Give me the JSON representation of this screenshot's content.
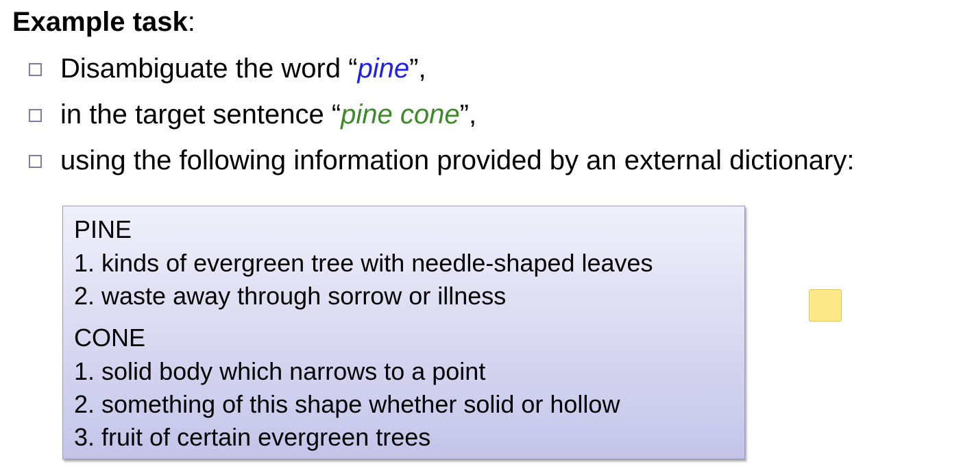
{
  "heading": {
    "bold": "Example task",
    "rest": ":"
  },
  "bullets": [
    {
      "before": "Disambiguate the word “",
      "keyword": "pine",
      "after": "”,"
    },
    {
      "before": "in the target sentence “",
      "keyword": "pine cone",
      "after": "”,"
    },
    {
      "text": "using the following information provided by an external dictionary:"
    }
  ],
  "dictionary": {
    "pine": {
      "headword": "PINE",
      "senses": [
        "1. kinds of evergreen tree with needle-shaped leaves",
        "2. waste away through sorrow or illness"
      ]
    },
    "cone": {
      "headword": "CONE",
      "senses": [
        "1. solid body which narrows to a point",
        "2. something of this shape whether solid or hollow",
        "3. fruit of certain evergreen trees"
      ]
    }
  },
  "colors": {
    "keyword_pine": "#1f1ff0",
    "keyword_pine_cone": "#3c8a28",
    "sticky_note": "#fbe98a"
  }
}
